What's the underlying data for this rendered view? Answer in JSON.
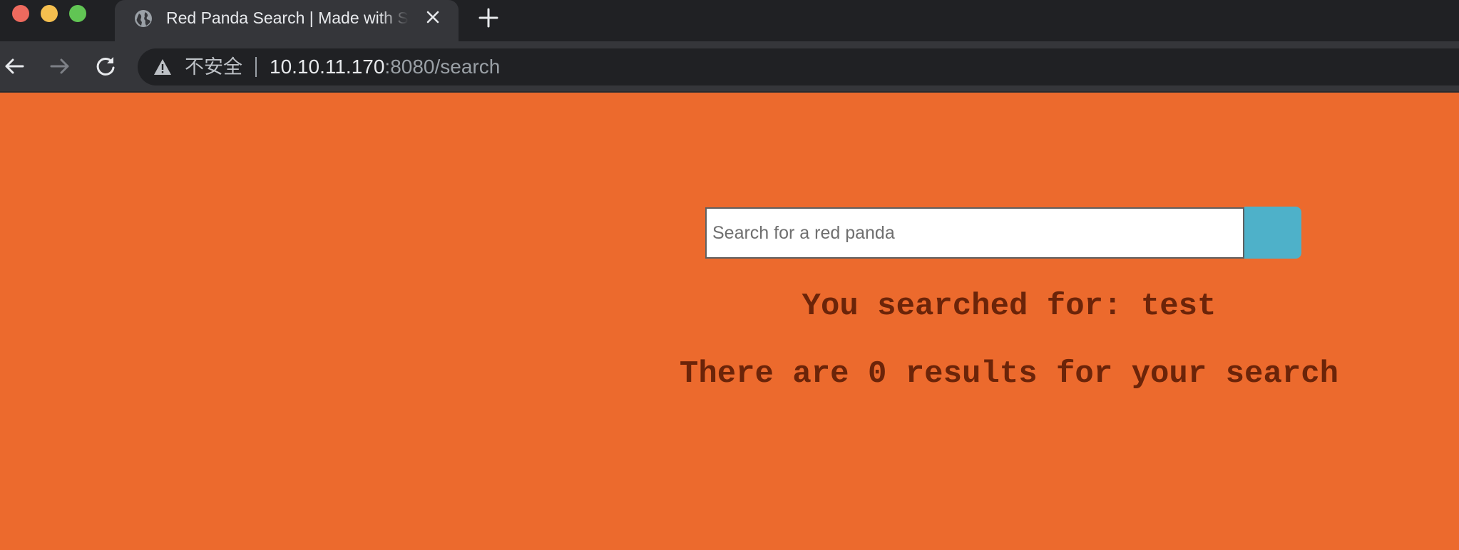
{
  "browser": {
    "tab": {
      "title": "Red Panda Search | Made with Spring Boot",
      "favicon": "globe-icon"
    },
    "new_tab_icon": "plus-icon",
    "nav": {
      "back_icon": "arrow-left-icon",
      "forward_icon": "arrow-right-icon",
      "reload_icon": "reload-icon"
    },
    "address_bar": {
      "security_icon": "warning-triangle-icon",
      "security_label": "不安全",
      "url_host": "10.10.11.170",
      "url_rest": ":8080/search"
    },
    "traffic_lights": [
      "#ee6a5e",
      "#f5bf4f",
      "#61c554"
    ]
  },
  "page": {
    "background_color": "#ec6a2d",
    "search": {
      "placeholder": "Search for a red panda",
      "value": "",
      "button_label": "",
      "button_color": "#4eb1c9"
    },
    "searched_text": "You searched for: test",
    "results_text": "There are 0 results for your search",
    "text_color": "#6b2409"
  }
}
